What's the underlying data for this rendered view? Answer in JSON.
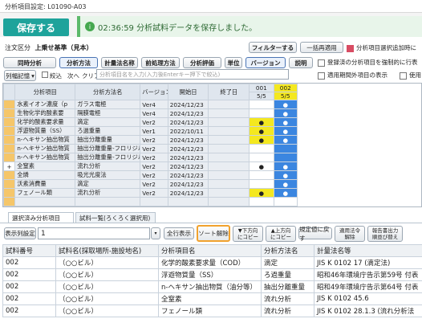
{
  "window": {
    "title": "分析項目設定: L01090-A03"
  },
  "toolbar": {
    "save_label": "保存する"
  },
  "toast": {
    "message": "02:36:59 分析試料データを保存しました。"
  },
  "order": {
    "label": "注文区分",
    "value": "上乗せ基準（見本）"
  },
  "filter_label": "フィルターする",
  "bulk_label": "一括再適用",
  "auto_check_label": "分析項目選択追加時に",
  "buttons": [
    "同時分析",
    "分析方法",
    "計量法名称",
    "前処理方法",
    "分析評価",
    "単位",
    "バージョン",
    "説明"
  ],
  "check_force": "登録済の分析項目を強制的に行表",
  "check_period": "適用期間外項目の表示",
  "check_use": "使用",
  "list_display": "列幅記憶",
  "narrow": "絞込",
  "next": "次へ",
  "clear": "クリア",
  "search_placeholder": "分析項目名を入力(入力後Enterキー押下で絞込)",
  "grid": {
    "headers": [
      "分析項目",
      "分析方法名",
      "バージョン",
      "開始日",
      "終了日",
      "001",
      "002"
    ],
    "subheaders": [
      "5/5",
      "5/5"
    ],
    "rows": [
      {
        "item": "水素イオン濃度（p",
        "method": "ガラス電極",
        "ver": "Ver4",
        "start": "2024/12/23",
        "end": "",
        "c1": "",
        "c2": "●"
      },
      {
        "item": "生物化学的酸素要",
        "method": "隔膜電極",
        "ver": "Ver4",
        "start": "2024/12/23",
        "end": "",
        "c1": "",
        "c2": "●"
      },
      {
        "item": "化学的酸素要求量",
        "method": "滴定",
        "ver": "Ver2",
        "start": "2024/12/23",
        "end": "",
        "c1": "●",
        "c2": "●"
      },
      {
        "item": "浮遊物質量（SS）",
        "method": "ろ過重量",
        "ver": "Ver1",
        "start": "2022/10/11",
        "end": "",
        "c1": "●",
        "c2": "●"
      },
      {
        "item": "n-ヘキサン抽出物質",
        "method": "抽出分離重量",
        "ver": "Ver2",
        "start": "2024/12/23",
        "end": "",
        "c1": "●",
        "c2": "●"
      },
      {
        "item": "n-ヘキサン抽出物質",
        "method": "抽出分離重量-フロリジル",
        "ver": "Ver2",
        "start": "2024/12/23",
        "end": "",
        "c1": "",
        "c2": ""
      },
      {
        "item": "n-ヘキサン抽出物質",
        "method": "抽出分離重量-フロリジル",
        "ver": "Ver2",
        "start": "2024/12/23",
        "end": "",
        "c1": "",
        "c2": ""
      },
      {
        "item": "全窒素",
        "method": "流れ分析",
        "ver": "Ver2",
        "start": "2024/12/23",
        "end": "",
        "c1": "●",
        "c2": "●"
      },
      {
        "item": "全燐",
        "method": "吸光光度法",
        "ver": "Ver2",
        "start": "2024/12/23",
        "end": "",
        "c1": "",
        "c2": "●"
      },
      {
        "item": "沃素消費量",
        "method": "滴定",
        "ver": "Ver2",
        "start": "2024/12/23",
        "end": "",
        "c1": "",
        "c2": "●"
      },
      {
        "item": "フェノール類",
        "method": "流れ分析",
        "ver": "Ver2",
        "start": "2024/12/23",
        "end": "",
        "c1": "●",
        "c2": "●"
      },
      {
        "item": "",
        "method": "",
        "ver": "",
        "start": "",
        "end": "",
        "c1": "",
        "c2": ""
      }
    ]
  },
  "tabs": [
    "選択済み分析項目",
    "試料一覧(ろくろく選択用)"
  ],
  "lower": {
    "display_label": "表示列設定",
    "count_value": "1",
    "all_show": "全行表示",
    "sort_clear": "ソート解除",
    "down_copy": "▼下方向\nにコピー",
    "up_copy": "▲上方向\nにコピー",
    "regulation_return": "規定値に戻す",
    "apply_release": "適用法令\n解除",
    "report_order": "報告書出力\n順並び替え",
    "headers": [
      "試料番号",
      "試料名(採取場所-施設地名)",
      "分析項目名",
      "分析方法名",
      "計量法名等"
    ],
    "rows": [
      [
        "002",
        "（○○ビル）",
        "化学的酸素要求量（COD）",
        "滴定",
        "JIS K 0102 17 (滴定法)"
      ],
      [
        "002",
        "（○○ビル）",
        "浮遊物質量（SS）",
        "ろ過重量",
        "昭和46年環境庁告示第59号 付表"
      ],
      [
        "002",
        "（○○ビル）",
        "n-ヘキサン抽出物質（油分等）",
        "抽出分離重量",
        "昭和49年環境庁告示第64号 付表"
      ],
      [
        "002",
        "（○○ビル）",
        "全窒素",
        "流れ分析",
        "JIS K 0102 45.6"
      ],
      [
        "002",
        "（○○ビル）",
        "フェノール類",
        "流れ分析",
        "JIS K 0102 28.1.3 (流れ分析法"
      ]
    ]
  }
}
